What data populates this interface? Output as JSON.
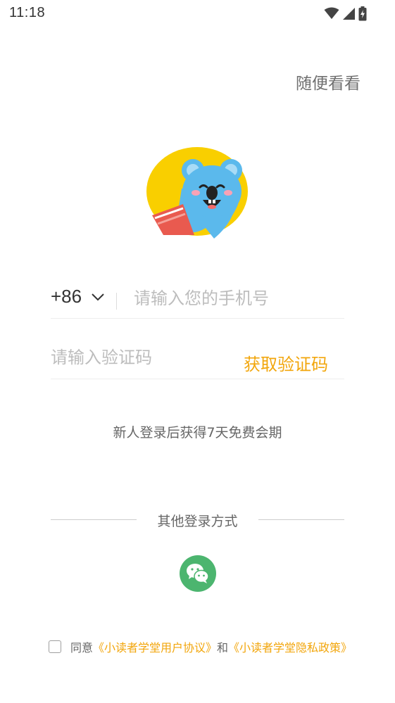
{
  "status_bar": {
    "time": "11:18",
    "icons": [
      "wifi-icon",
      "cellular-signal-icon",
      "battery-charging-icon"
    ]
  },
  "header": {
    "skip_label": "随便看看"
  },
  "login_form": {
    "country_code": "+86",
    "phone_placeholder": "请输入您的手机号",
    "code_placeholder": "请输入验证码",
    "get_code_label": "获取验证码"
  },
  "promo_text": "新人登录后获得7天免费会期",
  "other_login": {
    "label": "其他登录方式",
    "options": [
      "wechat-icon"
    ]
  },
  "agreement": {
    "prefix": "同意",
    "user_agreement": "《小读者学堂用户协议》",
    "conjunction": "和",
    "privacy_policy": "《小读者学堂隐私政策》",
    "checked": false
  },
  "colors": {
    "accent": "#f2a60c",
    "wechat": "#4cb56f",
    "logo_yellow": "#f9cf00",
    "logo_blue": "#5bb9ec"
  }
}
